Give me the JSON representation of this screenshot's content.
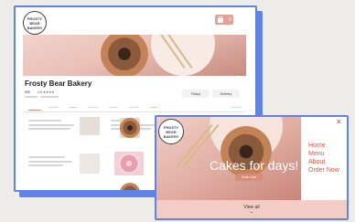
{
  "desktop": {
    "logo_text": "FROSTY BEAR BAKERY",
    "business_name": "Frosty Bear Bakery",
    "info": [
      "$$$",
      "4.8 ★★★★"
    ],
    "actions": [
      "Pickup",
      "Delivery"
    ],
    "cart_count": "0"
  },
  "mobile": {
    "logo_text": "FROSTY BEAR BAKERY",
    "tagline": "Cakes for days!",
    "order_button": "Order now",
    "menu": [
      "Home",
      "Menu",
      "About",
      "Order Now"
    ],
    "view_all": "View all",
    "close_icon": "close-icon",
    "chevron_icon": "chevron-down-icon"
  },
  "colors": {
    "accent_blue": "#5f82e8",
    "brand_red": "#e0513c",
    "pink": "#f3cdc5"
  }
}
